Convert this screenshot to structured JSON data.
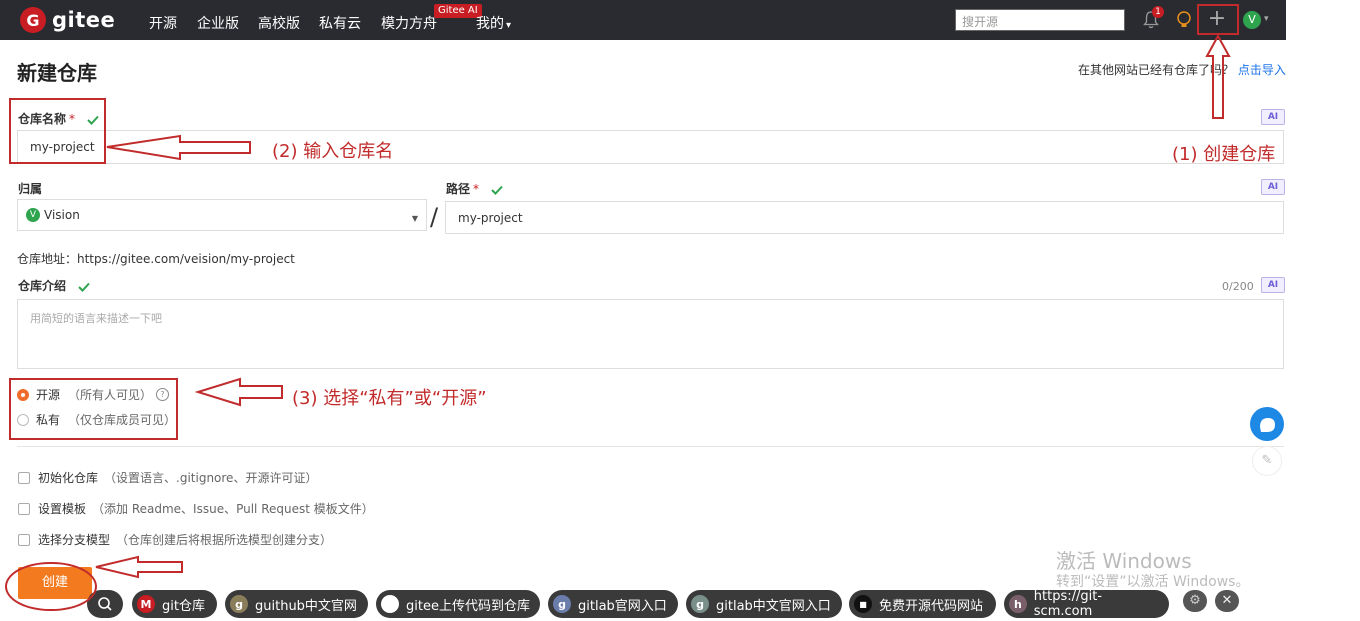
{
  "topbar": {
    "logo_mark": "G",
    "logo_text": "gitee",
    "nav": [
      "开源",
      "企业版",
      "高校版",
      "私有云",
      "模力方舟",
      "我的"
    ],
    "ai_badge": "Gitee AI",
    "search_placeholder": "搜开源",
    "notification_count": "1",
    "add_symbol": "+",
    "avatar_letter": "V"
  },
  "page": {
    "title": "新建仓库",
    "import_prompt": "在其他网站已经有仓库了吗？",
    "import_link": "点击导入"
  },
  "form": {
    "ai_tag": "AI",
    "required_mark": "*",
    "repo_name_label": "仓库名称",
    "repo_name_value": "my-project",
    "owner_label": "归属",
    "owner_value": "Vision",
    "owner_avatar": "V",
    "slash": "/",
    "path_label": "路径",
    "path_value": "my-project",
    "repo_address": "仓库地址：https://gitee.com/veision/my-project",
    "intro_label": "仓库介绍",
    "intro_counter": "0/200",
    "intro_placeholder": "用简短的语言来描述一下吧",
    "visibility": {
      "public_label": "开源",
      "public_hint": "（所有人可见）",
      "private_label": "私有",
      "private_hint": "（仅仓库成员可见）",
      "selected": "public",
      "help": "?"
    },
    "options": [
      {
        "label": "初始化仓库",
        "hint": "（设置语言、.gitignore、开源许可证）"
      },
      {
        "label": "设置模板",
        "hint": "（添加 Readme、Issue、Pull Request 模板文件）"
      },
      {
        "label": "选择分支模型",
        "hint": "（仓库创建后将根据所选模型创建分支）"
      }
    ],
    "create_button": "创建"
  },
  "annotations": {
    "step1": "(1) 创建仓库",
    "step2": "(2) 输入仓库名",
    "step3": "(3) 选择“私有”或“开源”",
    "annotation_color": "#c22b2b"
  },
  "watermark": {
    "line1": "激活 Windows",
    "line2": "转到“设置”以激活 Windows。"
  },
  "taskbar": {
    "chips": [
      {
        "icon": "M",
        "label": "git仓库",
        "color": "#c71d23"
      },
      {
        "icon": "g",
        "label": "guithub中文官网",
        "color": "#8a7d5a"
      },
      {
        "icon": "",
        "label": "gitee上传代码到仓库",
        "color": "#ffffff"
      },
      {
        "icon": "g",
        "label": "gitlab官网入口",
        "color": "#6b7dab"
      },
      {
        "icon": "g",
        "label": "gitlab中文官网入口",
        "color": "#7a8f8a"
      },
      {
        "icon": "■",
        "label": "免费开源代码网站",
        "color": "#111111"
      },
      {
        "icon": "h",
        "label": "https://git-scm.com",
        "color": "#7a5f6a"
      }
    ],
    "gear": "⚙",
    "close": "✕"
  },
  "colors": {
    "topbar_bg": "#2a2b30",
    "brand_red": "#c71d23",
    "create_orange": "#f37a1f",
    "check_green": "#2fa44f"
  }
}
